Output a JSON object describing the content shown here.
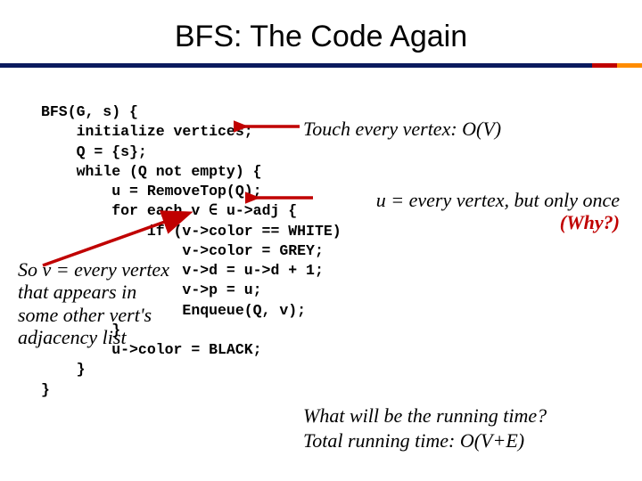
{
  "title": "BFS: The Code Again",
  "code": "BFS(G, s) {\n    initialize vertices;\n    Q = {s};\n    while (Q not empty) {\n        u = RemoveTop(Q);\n        for each v ∈ u->adj {\n            if (v->color == WHITE)\n                v->color = GREY;\n                v->d = u->d + 1;\n                v->p = u;\n                Enqueue(Q, v);\n        }\n        u->color = BLACK;\n    }\n}",
  "annotations": {
    "touch": "Touch every vertex: O(V)",
    "u_once": "u = every vertex, but only once",
    "why": "(Why?)",
    "so_v_l1": "So v = every vertex",
    "so_v_l2": "that appears in",
    "so_v_l3": "some other vert's",
    "so_v_l4": "adjacency list"
  },
  "question": {
    "q1": "What will be the running time?",
    "q2": "Total running time: O(V+E)"
  }
}
